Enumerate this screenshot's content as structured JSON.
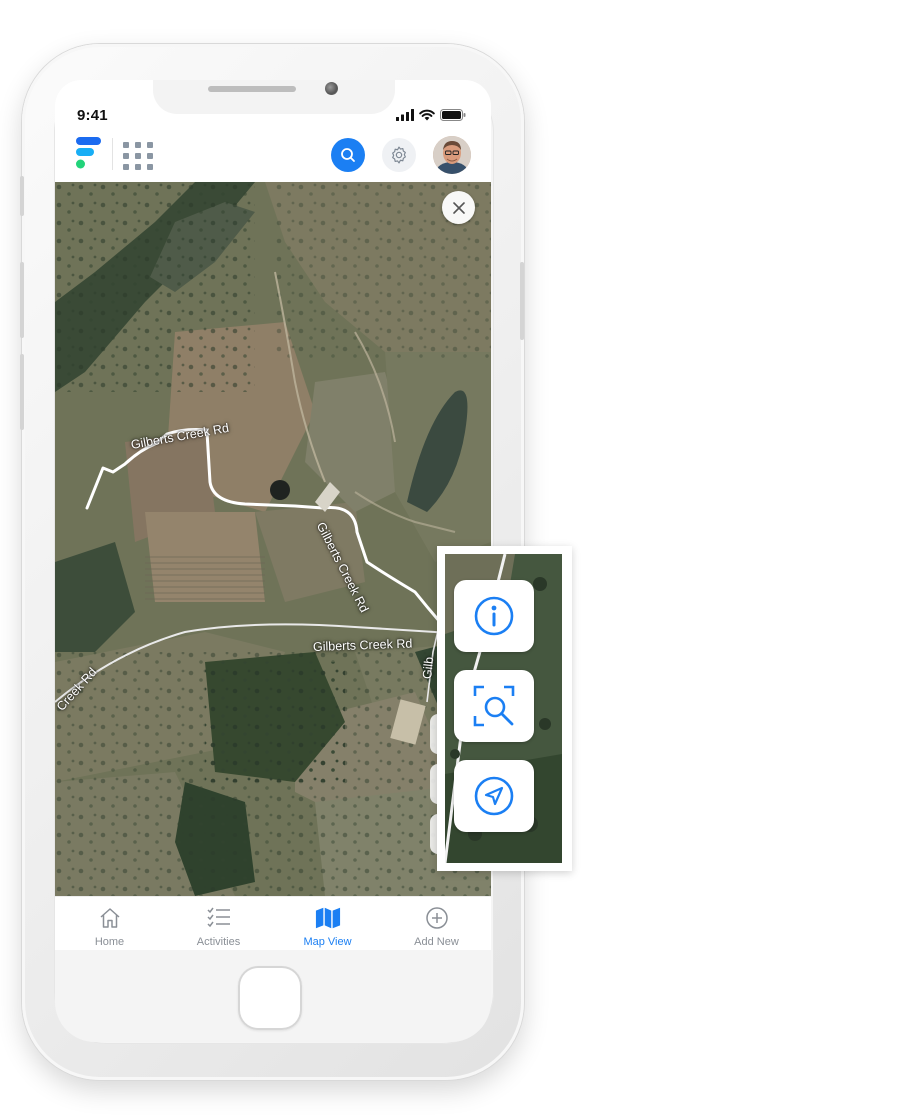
{
  "status_bar": {
    "time": "9:41"
  },
  "header": {
    "logo_icon": "app-logo-icon",
    "apps_icon": "grid-icon",
    "search_icon": "search-icon",
    "settings_icon": "gear-icon",
    "avatar_icon": "user-avatar",
    "accent_color": "#1b7ff3"
  },
  "map": {
    "labels": [
      "Gilberts Creek Rd",
      "Gilberts Creek Rd",
      "Gilberts Creek Rd",
      "Creek Rd",
      "Gilb"
    ],
    "close_icon": "close-icon"
  },
  "map_controls": [
    {
      "icon": "info-icon"
    },
    {
      "icon": "zoom-to-extent-icon"
    },
    {
      "icon": "location-arrow-icon"
    }
  ],
  "tabbar": {
    "tabs": [
      {
        "label": "Home",
        "icon": "home-icon",
        "active": false
      },
      {
        "label": "Activities",
        "icon": "checklist-icon",
        "active": false
      },
      {
        "label": "Map View",
        "icon": "map-icon",
        "active": true
      },
      {
        "label": "Add New",
        "icon": "plus-circle-icon",
        "active": false
      }
    ]
  }
}
